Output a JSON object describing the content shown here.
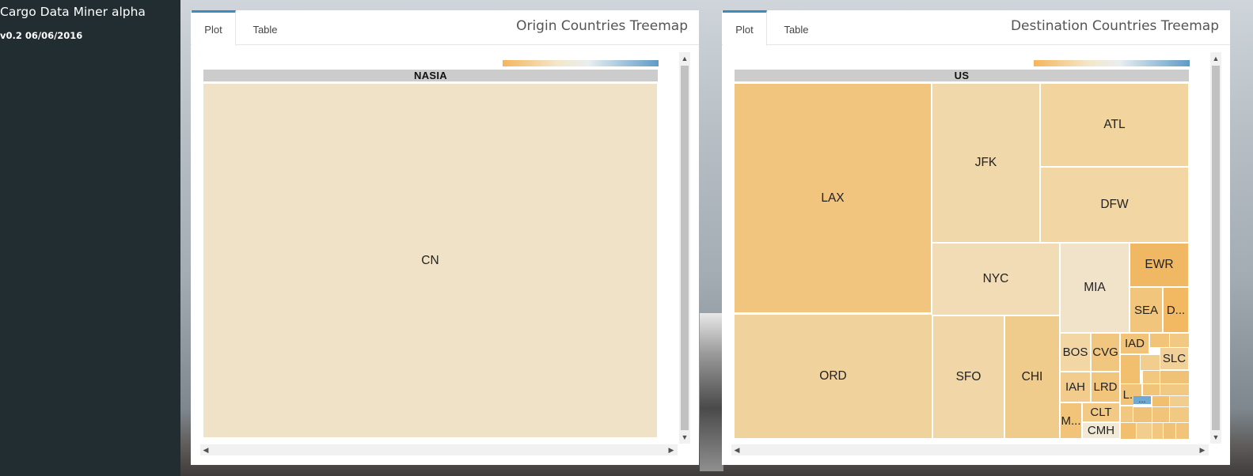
{
  "app": {
    "title": "Cargo Data Miner alpha",
    "version": "v0.2 06/06/2016"
  },
  "colors": {
    "sidebar": "#222d32",
    "accent": "#3c8dbc",
    "header": "#cccccc"
  },
  "panels": [
    {
      "title": "Origin Countries Treemap",
      "tabs": [
        {
          "label": "Plot",
          "active": true
        },
        {
          "label": "Table",
          "active": false
        }
      ],
      "treemap": {
        "group": "NASIA",
        "cells": [
          {
            "label": "CN",
            "color": "#f0e2c6"
          }
        ]
      }
    },
    {
      "title": "Destination Countries Treemap",
      "tabs": [
        {
          "label": "Plot",
          "active": true
        },
        {
          "label": "Table",
          "active": false
        }
      ],
      "treemap": {
        "group": "US",
        "cells": [
          {
            "label": "LAX",
            "color": "#f1c57e"
          },
          {
            "label": "ORD",
            "color": "#f0d29c"
          },
          {
            "label": "JFK",
            "color": "#f1d8ab"
          },
          {
            "label": "ATL",
            "color": "#f2d49e"
          },
          {
            "label": "DFW",
            "color": "#f2d6a4"
          },
          {
            "label": "NYC",
            "color": "#f2dcb5"
          },
          {
            "label": "MIA",
            "color": "#f1e3ca"
          },
          {
            "label": "EWR",
            "color": "#f1b863"
          },
          {
            "label": "SEA",
            "color": "#f2c57c"
          },
          {
            "label": "D...",
            "color": "#f2b962"
          },
          {
            "label": "SFO",
            "color": "#f1d7a8"
          },
          {
            "label": "CHI",
            "color": "#f0cc8c"
          },
          {
            "label": "BOS",
            "color": "#f2d6a4"
          },
          {
            "label": "CVG",
            "color": "#f1c67f"
          },
          {
            "label": "IAD",
            "color": "#f1c479"
          },
          {
            "label": "SLC",
            "color": "#f2d09a"
          },
          {
            "label": "IAH",
            "color": "#f1cc8c"
          },
          {
            "label": "LRD",
            "color": "#f2c57c"
          },
          {
            "label": "L...",
            "color": "#f2c47a"
          },
          {
            "label": "CLT",
            "color": "#f2ca86"
          },
          {
            "label": "M...",
            "color": "#f1c479"
          },
          {
            "label": "CMH",
            "color": "#f1e8d6"
          },
          {
            "label": "...",
            "color": "#6fa8d3"
          }
        ]
      }
    }
  ]
}
